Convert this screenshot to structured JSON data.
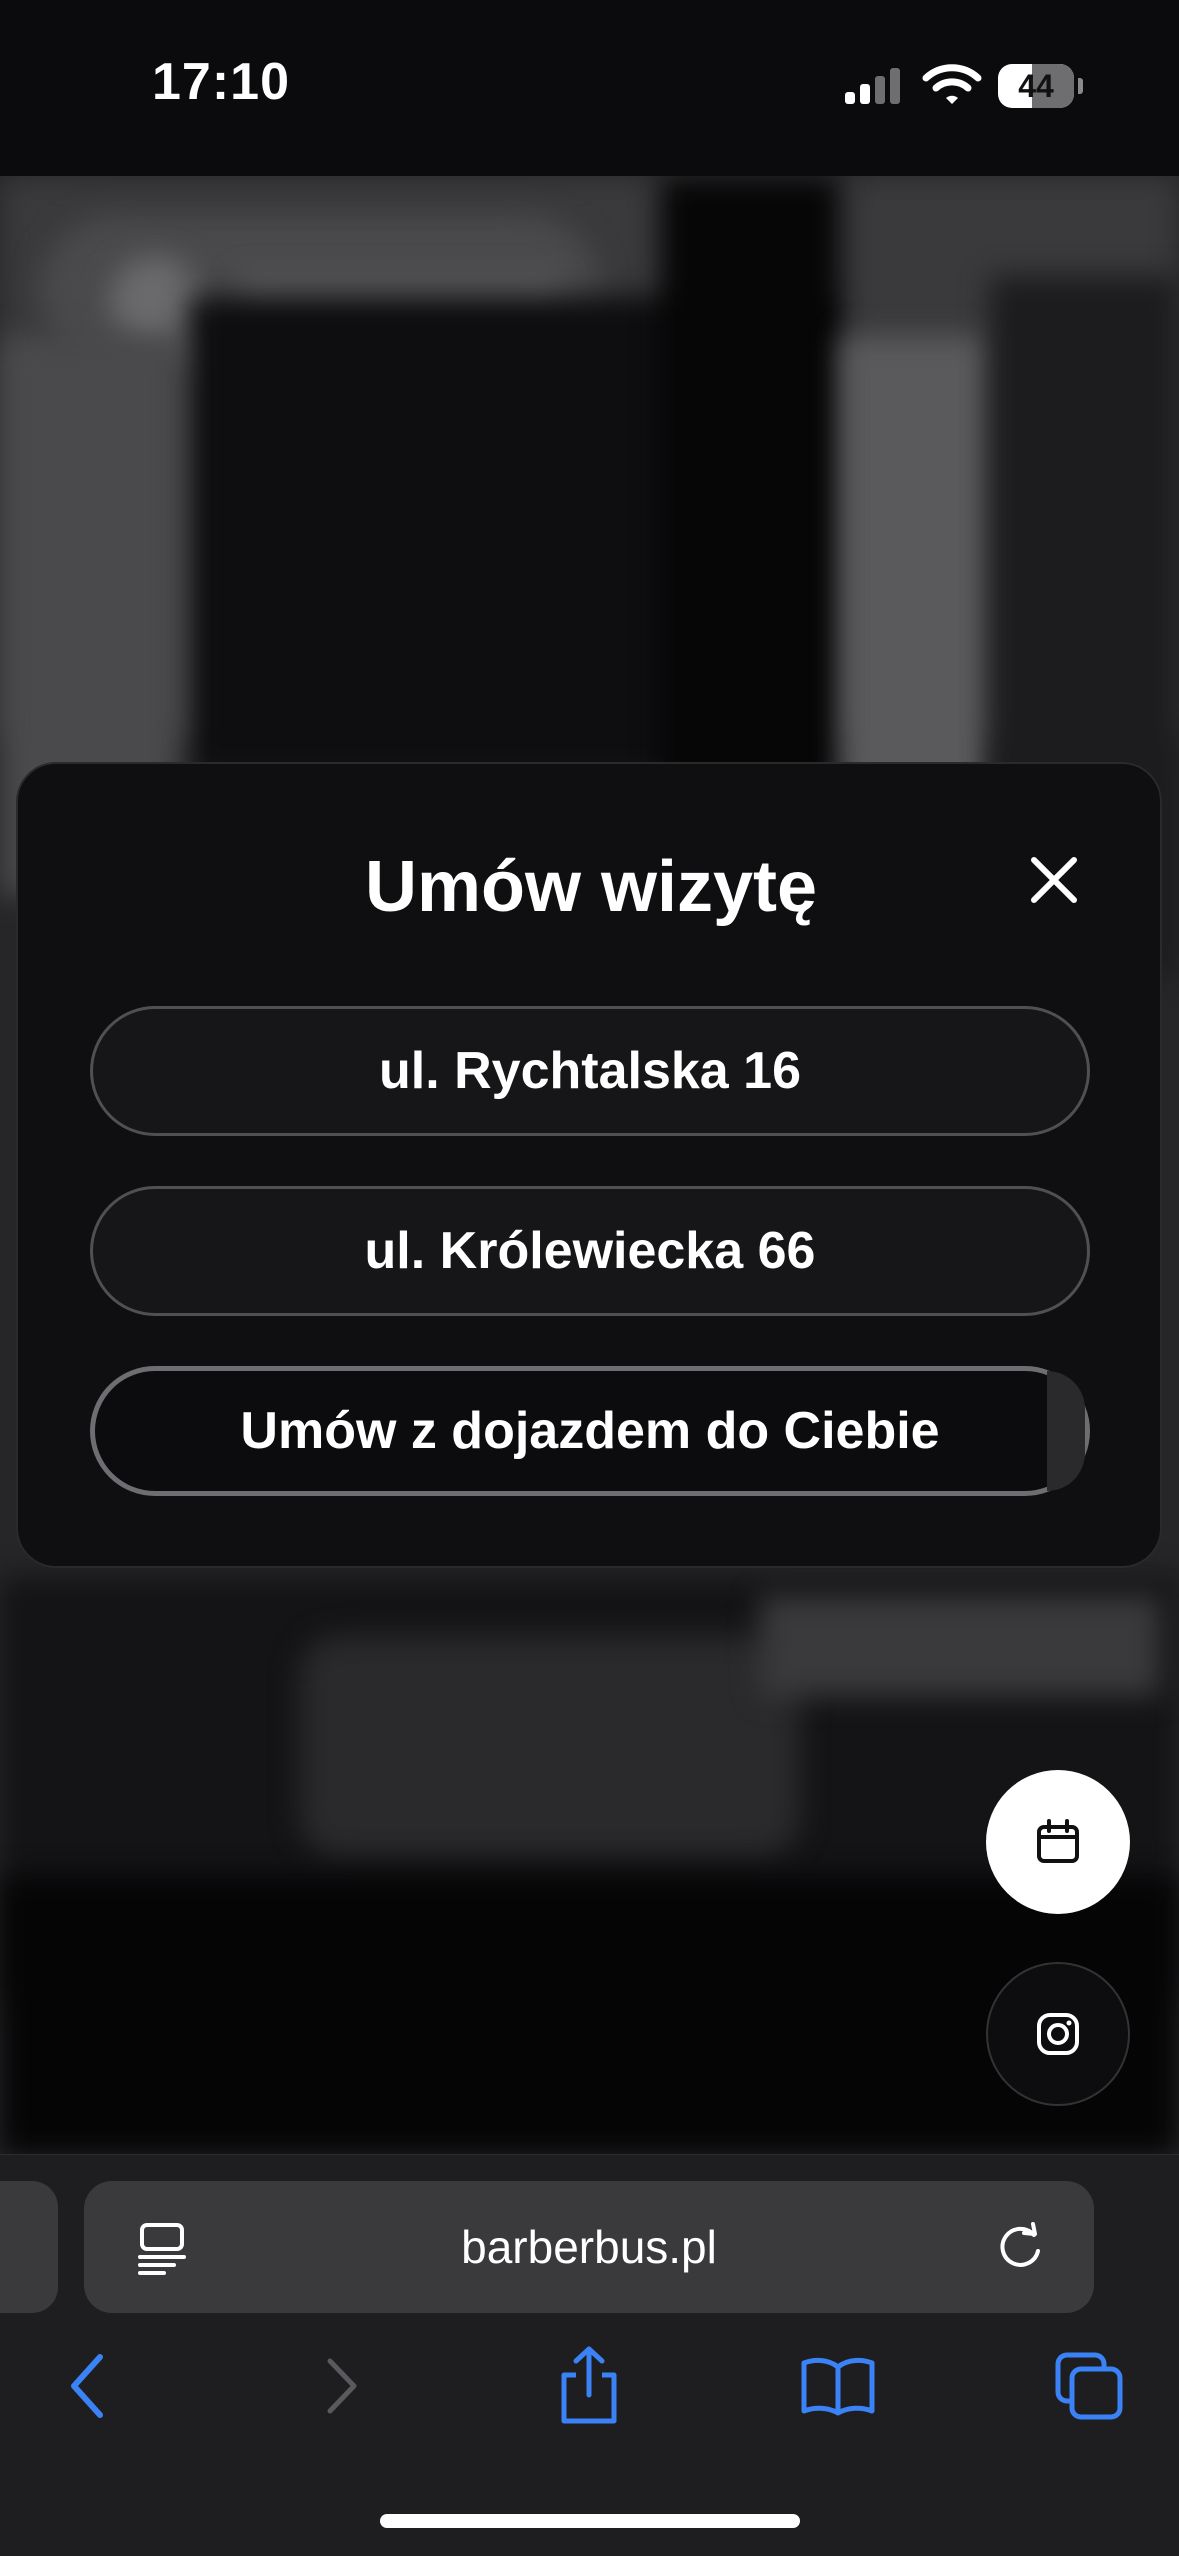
{
  "status_bar": {
    "time": "17:10",
    "battery": "44"
  },
  "modal": {
    "title": "Umów wizytę",
    "buttons": [
      {
        "label": "ul. Rychtalska 16"
      },
      {
        "label": "ul. Królewiecka 66"
      },
      {
        "label": "Umów z dojazdem do Ciebie"
      }
    ]
  },
  "floating_actions": {
    "calendar_icon": "calendar-icon",
    "instagram_icon": "instagram-icon"
  },
  "browser": {
    "url": "barberbus.pl",
    "toolbar": [
      "back-icon",
      "forward-icon",
      "share-icon",
      "bookmarks-icon",
      "tabs-icon"
    ],
    "accent_color": "#3b82f6"
  }
}
